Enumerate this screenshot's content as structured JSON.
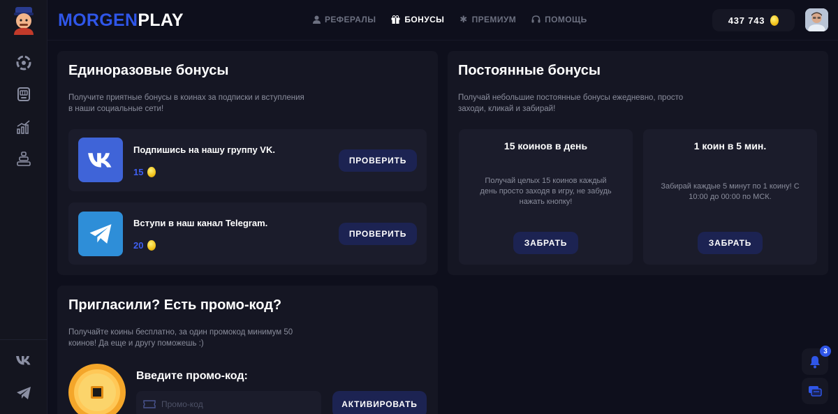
{
  "brand": {
    "part1": "MORGEN",
    "part2": "PLAY"
  },
  "nav": [
    {
      "label": "РЕФЕРАЛЫ",
      "icon": "user-icon",
      "active": false
    },
    {
      "label": "БОНУСЫ",
      "icon": "gift-icon",
      "active": true
    },
    {
      "label": "ПРЕМИУМ",
      "icon": "star-icon",
      "active": false
    },
    {
      "label": "ПОМОЩЬ",
      "icon": "headset-icon",
      "active": false
    }
  ],
  "balance": {
    "value": "437 743",
    "icon": "coin-icon"
  },
  "sidebar": {
    "items": [
      {
        "icon": "roulette-icon"
      },
      {
        "icon": "slot-machine-icon"
      },
      {
        "icon": "chart-icon"
      },
      {
        "icon": "tower-icon"
      }
    ],
    "socials": [
      {
        "icon": "vk-icon"
      },
      {
        "icon": "telegram-icon"
      }
    ]
  },
  "onetime": {
    "title": "Единоразовые бонусы",
    "desc_line1": "Получите приятные бонусы в коинах за подписки и вступления",
    "desc_line2": "в наши социальные сети!",
    "items": [
      {
        "title": "Подпишись на нашу группу VK.",
        "reward": "15",
        "button": "ПРОВЕРИТЬ",
        "icon": "vk-icon"
      },
      {
        "title": "Вступи в наш канал Telegram.",
        "reward": "20",
        "button": "ПРОВЕРИТЬ",
        "icon": "telegram-icon"
      }
    ]
  },
  "permanent": {
    "title": "Постоянные бонусы",
    "desc_line1": "Получай небольшие постоянные бонусы ежедневно, просто",
    "desc_line2": "заходи, кликай и забирай!",
    "cards": [
      {
        "title": "15 коинов в день",
        "desc_lines": [
          "Получай целых 15 коинов каждый",
          "день просто заходя в игру, не забудь",
          "нажать кнопку!"
        ],
        "button": "ЗАБРАТЬ"
      },
      {
        "title": "1 коин в 5 мин.",
        "desc_lines": [
          "Забирай каждые 5 минут по 1 коину! С",
          "10:00 до 00:00 по МСК."
        ],
        "button": "ЗАБРАТЬ"
      }
    ]
  },
  "promo": {
    "title": "Пригласили? Есть промо-код?",
    "desc_line1": "Получайте коины бесплатно, за один промокод минимум 50",
    "desc_line2": "коинов! Да еще и другу поможешь :)",
    "label": "Введите промо-код:",
    "placeholder": "Промо-код",
    "button": "АКТИВИРОВАТЬ"
  },
  "notifications": {
    "count": "3"
  },
  "colors": {
    "accent": "#2f56e8",
    "bg": "#0e0f1c",
    "panel": "#151623",
    "button": "#1c2352",
    "coin": "#f2c21a"
  }
}
